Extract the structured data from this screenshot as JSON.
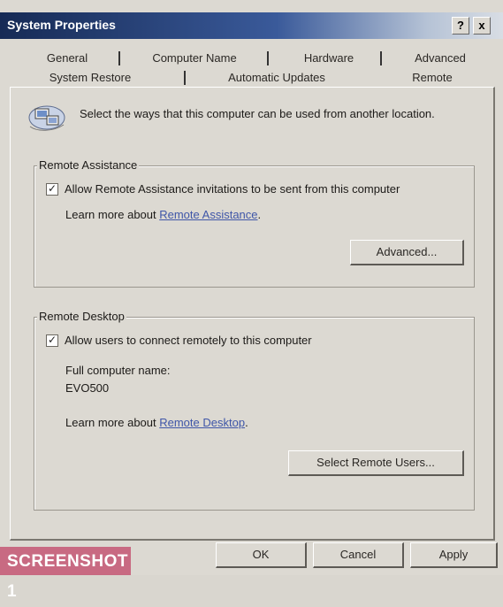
{
  "window": {
    "title": "System Properties",
    "help_button": "?",
    "close_button": "x"
  },
  "tabs": {
    "row_back": [
      "General",
      "Computer Name",
      "Hardware",
      "Advanced"
    ],
    "row_front": [
      "System Restore",
      "Automatic Updates",
      "Remote"
    ],
    "selected": "Remote"
  },
  "intro": {
    "icon": "computer-network-icon",
    "text": "Select the ways that this computer can be used from another location."
  },
  "remote_assistance": {
    "group_title": "Remote Assistance",
    "checkbox_label": "Allow Remote Assistance invitations to be sent from this computer",
    "checked": true,
    "learn_more_prefix": "Learn more about ",
    "learn_more_link": "Remote Assistance",
    "learn_more_suffix": ".",
    "advanced_button": "Advanced..."
  },
  "remote_desktop": {
    "group_title": "Remote Desktop",
    "checkbox_label": "Allow users to connect remotely to this computer",
    "checked": true,
    "computer_name_label": "Full computer name:",
    "computer_name_value": "EVO500",
    "learn_more_prefix": "Learn more about ",
    "learn_more_link": "Remote Desktop",
    "learn_more_suffix": ".",
    "select_users_button": "Select Remote Users..."
  },
  "footer": {
    "ok_button": "OK",
    "cancel_button": "Cancel",
    "apply_button": "Apply"
  },
  "watermark": {
    "text": "SCREENSHOT 1"
  },
  "colors": {
    "title_bar_start": "#162a55",
    "dialog_face": "#dcd9d2",
    "link": "#3f56a8",
    "watermark": "#c86a82"
  }
}
